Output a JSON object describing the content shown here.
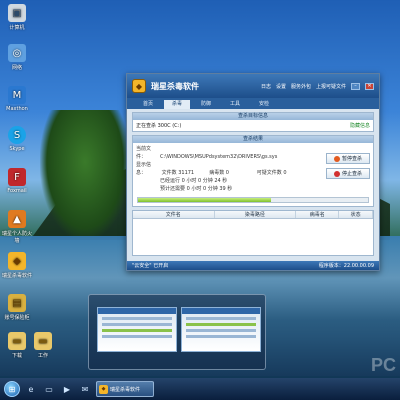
{
  "desktop": {
    "icons": [
      {
        "label": "计算机",
        "icon": "computer-icon",
        "color": "#cfd8e0"
      },
      {
        "label": "网络",
        "icon": "network-icon",
        "color": "#5fa0e0"
      },
      {
        "label": "Maxthon",
        "icon": "maxthon-icon",
        "color": "#2a78d0"
      },
      {
        "label": "Skype",
        "icon": "skype-icon",
        "color": "#1aa3e8"
      },
      {
        "label": "Foxmail",
        "icon": "foxmail-icon",
        "color": "#c0282c"
      },
      {
        "label": "瑞星个人防火墙",
        "icon": "firewall-icon",
        "color": "#e07a20"
      },
      {
        "label": "瑞星杀毒软件",
        "icon": "antivirus-icon",
        "color": "#f3b52a"
      },
      {
        "label": "账号保险柜",
        "icon": "safe-icon",
        "color": "#d8b040"
      },
      {
        "label": "下载",
        "icon": "download-folder-icon",
        "color": "#e8c86a"
      },
      {
        "label": "工作",
        "icon": "work-folder-icon",
        "color": "#e8c86a"
      }
    ]
  },
  "app": {
    "title": "瑞星杀毒软件",
    "logo_icon": "shield-lion-icon",
    "top_menu": [
      "日志",
      "设置",
      "服务外包",
      "上报可疑文件"
    ],
    "tabs": [
      "首页",
      "杀毒",
      "防御",
      "工具",
      "安检"
    ],
    "active_tab": 1,
    "scan_target": {
      "header": "查杀目标信息",
      "current_label": "正在查杀 300C (C:)",
      "link": "隐藏信息"
    },
    "results": {
      "header": "查杀结果",
      "file_label": "当前文件：",
      "file_path": "C:\\WINDOWS\\MSUPdsystem32\\DRIVERS\\gs.sys",
      "type_label": "显示信息：",
      "stats": [
        {
          "label": "文件数",
          "value": "31171"
        },
        {
          "label": "病毒数",
          "value": "0"
        },
        {
          "label": "可疑文件数",
          "value": "0"
        }
      ],
      "elapsed_label": "已经运行",
      "elapsed": "0 小时 0 分钟 24 秒",
      "remaining_label": "预计还需要",
      "remaining": "0 小时 0 分钟 39 秒",
      "progress": 0.58,
      "pause_button": "暂停查杀",
      "stop_button": "停止查杀"
    },
    "table": {
      "columns": [
        "文件名",
        "染毒路径",
        "病毒名",
        "状态"
      ]
    },
    "status": {
      "left": "\"云安全\" 已开启",
      "right": "程序版本：22.00.00.09"
    }
  },
  "taskbar": {
    "start_icon": "windows-start-icon",
    "pinned": [
      "ie-icon",
      "explorer-icon",
      "media-player-icon",
      "mail-icon"
    ],
    "running_label": "瑞星杀毒软件"
  },
  "watermark": "PC"
}
